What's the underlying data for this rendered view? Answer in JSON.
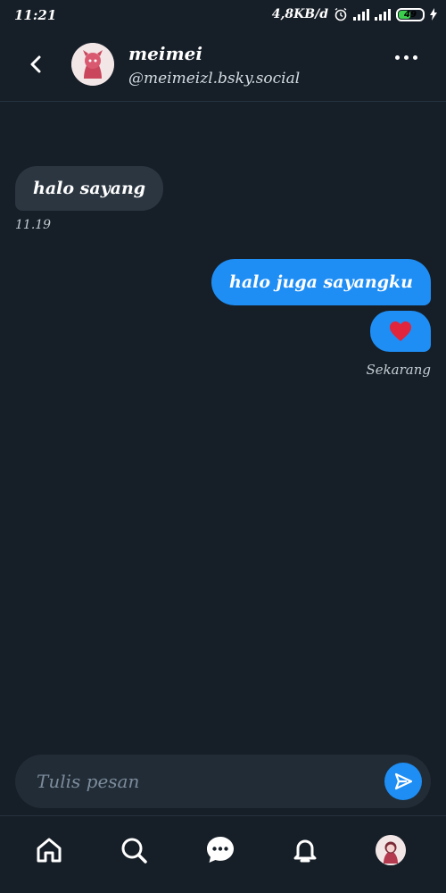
{
  "status_bar": {
    "time": "11:21",
    "speed": "4,8KB/d",
    "battery": "49"
  },
  "header": {
    "name": "meimei",
    "handle": "@meimeizl.bsky.social"
  },
  "messages": [
    {
      "from": "them",
      "text": "halo sayang",
      "time": "11.19"
    },
    {
      "from": "me",
      "text": "halo juga sayangku"
    },
    {
      "from": "me",
      "emoji": "heart",
      "time": "Sekarang"
    }
  ],
  "composer": {
    "placeholder": "Tulis pesan",
    "value": ""
  },
  "nav": {
    "items": [
      "home-icon",
      "search-icon",
      "chat-icon",
      "notifications-icon",
      "profile-avatar"
    ]
  },
  "colors": {
    "background": "#161e27",
    "accent": "#1e8ef5",
    "incoming_bubble": "#2b3641",
    "heart": "#e0253c"
  }
}
